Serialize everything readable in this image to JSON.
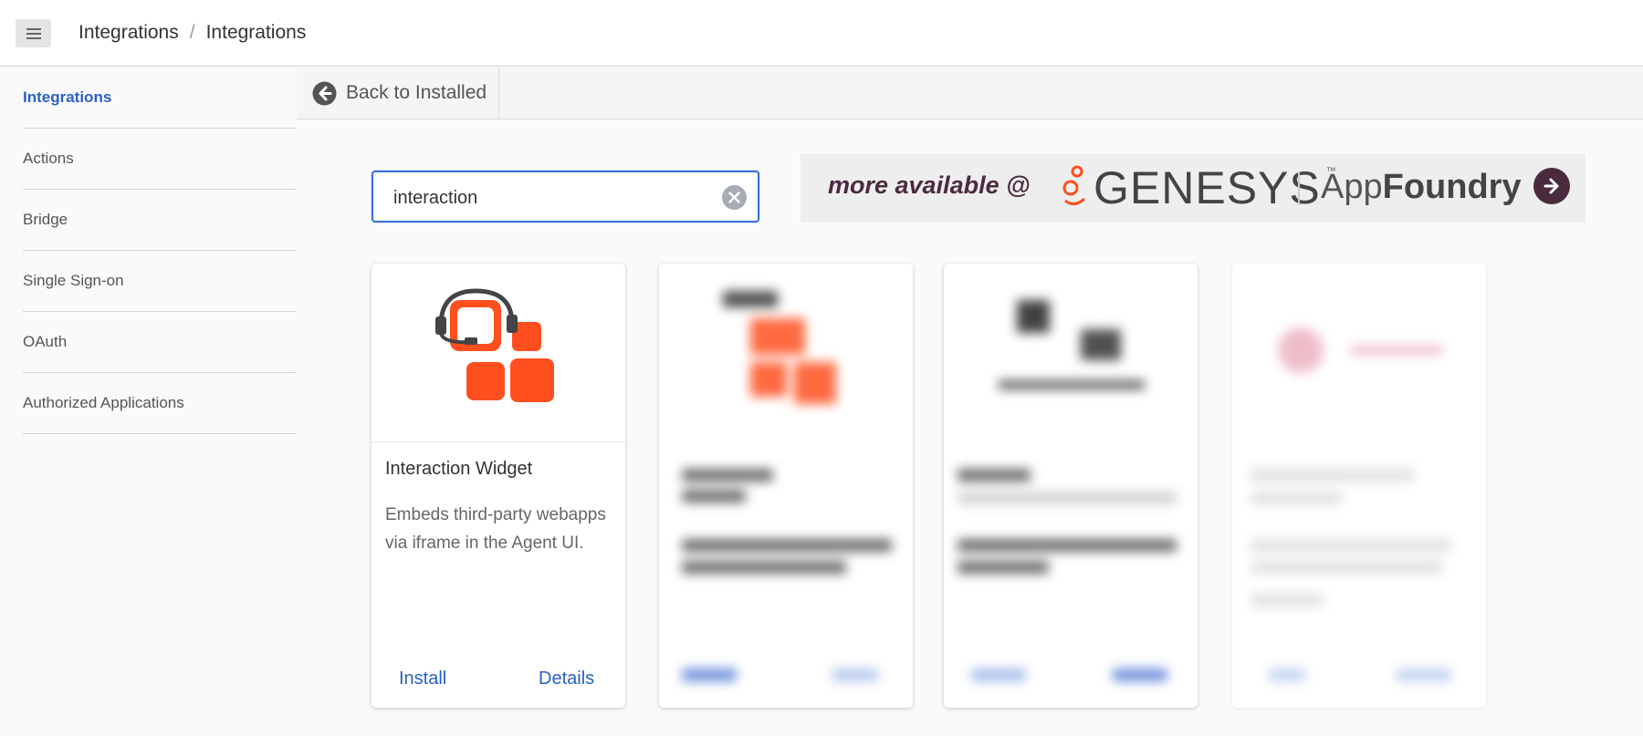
{
  "header": {
    "breadcrumb": [
      "Integrations",
      "Integrations"
    ],
    "breadcrumb_separator": "/"
  },
  "sidebar": {
    "items": [
      {
        "label": "Integrations",
        "active": true
      },
      {
        "label": "Actions"
      },
      {
        "label": "Bridge"
      },
      {
        "label": "Single Sign-on"
      },
      {
        "label": "OAuth"
      },
      {
        "label": "Authorized Applications"
      }
    ]
  },
  "toolbar": {
    "back_label": "Back to Installed"
  },
  "search": {
    "value": "interaction"
  },
  "promo": {
    "more_text": "more available @",
    "genesys_text": "GENESYS",
    "tm": "™",
    "app_text": "App",
    "foundry_text": "Foundry"
  },
  "cards": [
    {
      "title": "Interaction Widget",
      "description": "Embeds third-party webapps via iframe in the Agent UI.",
      "install_label": "Install",
      "details_label": "Details",
      "icon": "interaction-widget-logo"
    }
  ],
  "colors": {
    "accent": "#2a60c8",
    "brand_orange": "#ff4f1f",
    "promo_purple": "#4a2b3e"
  }
}
